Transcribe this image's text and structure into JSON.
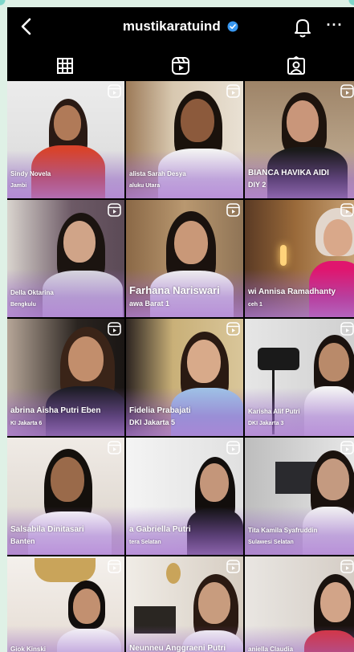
{
  "header": {
    "username": "mustikaratuind",
    "back_icon": "chevron-left-icon",
    "verified_icon": "verified-badge-icon",
    "bell_icon": "bell-icon",
    "more_icon": "more-horizontal-icon",
    "more_label": "···"
  },
  "tabs": [
    {
      "name": "grid",
      "icon": "grid-icon",
      "active": true
    },
    {
      "name": "reels",
      "icon": "reels-icon",
      "active": false
    },
    {
      "name": "tagged",
      "icon": "tagged-icon",
      "active": false
    }
  ],
  "posts": [
    {
      "name": "Sindy Novela",
      "region": "Jambi"
    },
    {
      "name": "alista Sarah Desya",
      "region": "aluku Utara"
    },
    {
      "name": "BIANCA HAVIKA AIDI",
      "region": "DIY 2"
    },
    {
      "name": "Della Oktarina",
      "region": "Bengkulu"
    },
    {
      "name": "Farhana Nariswari",
      "region": "awa Barat 1"
    },
    {
      "name": "wi Annisa Ramadhanty",
      "region": "ceh 1"
    },
    {
      "name": "abrina Aisha Putri Eben",
      "region": "KI Jakarta 6"
    },
    {
      "name": "Fidelia Prabajati",
      "region": "DKI Jakarta 5"
    },
    {
      "name": "Karisha Alif Putri",
      "region": "DKI Jakarta 3"
    },
    {
      "name": "Salsabila Dinitasari",
      "region": "Banten"
    },
    {
      "name": "a Gabriella Putri",
      "region": "tera Selatan"
    },
    {
      "name": "Tita Kamila Syafruddin",
      "region": "Sulawesi Selatan"
    },
    {
      "name": "Giok Kinski",
      "region": ""
    },
    {
      "name": "Neunneu Anggraeni Putri",
      "region": ""
    },
    {
      "name": "aniella Claudia",
      "region": ""
    }
  ]
}
